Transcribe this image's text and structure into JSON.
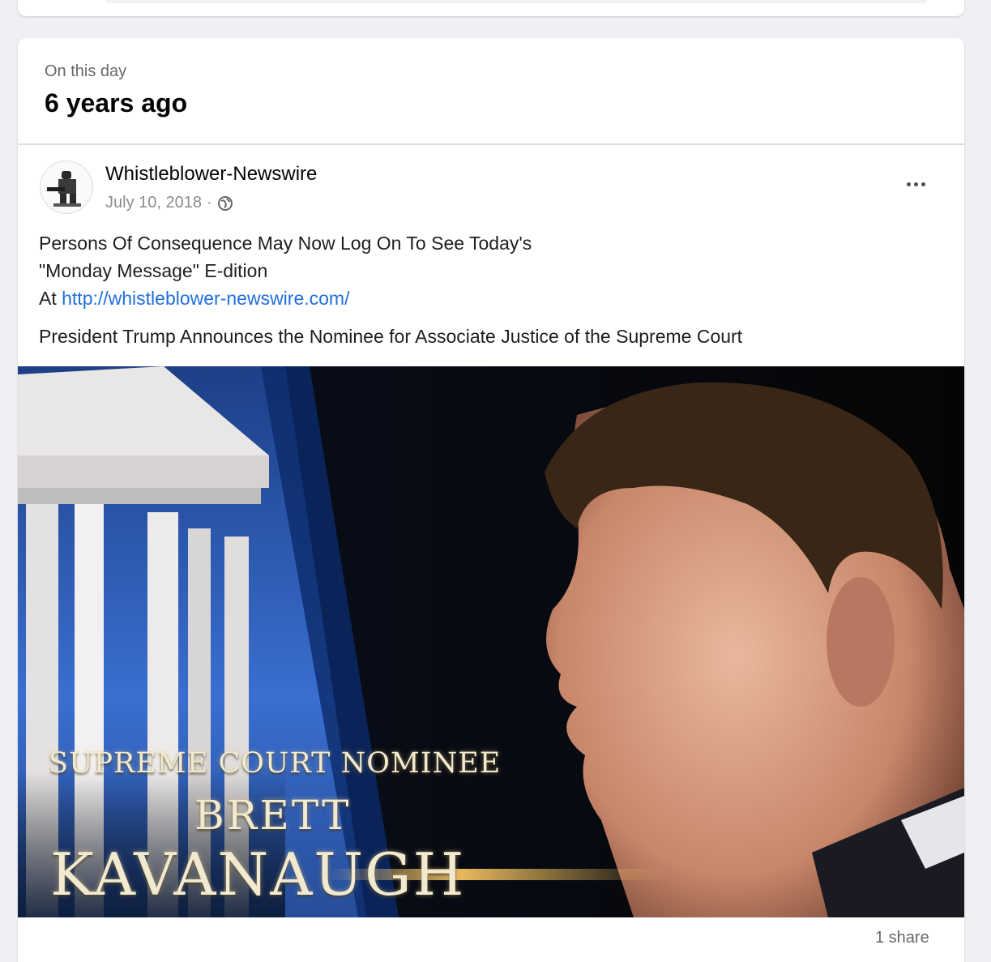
{
  "memory": {
    "label": "On this day",
    "title": "6 years ago"
  },
  "post": {
    "author": "Whistleblower-Newswire",
    "date": "July 10, 2018",
    "separator": "·",
    "privacy_icon": "globe-icon",
    "options_icon": "more-options-icon",
    "text_line1": "Persons Of Consequence May Now Log On To See Today's",
    "text_line2": "\"Monday Message\" E-dition",
    "text_line3_prefix": "At ",
    "link": "http://whistleblower-newswire.com/",
    "text_line4": "President Trump Announces the Nominee for Associate Justice of the Supreme Court",
    "image_text": {
      "line1": "SUPREME COURT NOMINEE",
      "line2": "BRETT",
      "line3": "KAVANAUGH"
    },
    "shares": "1 share"
  },
  "colors": {
    "link": "#216fdb",
    "muted": "#65676b",
    "background": "#eef0f3"
  }
}
